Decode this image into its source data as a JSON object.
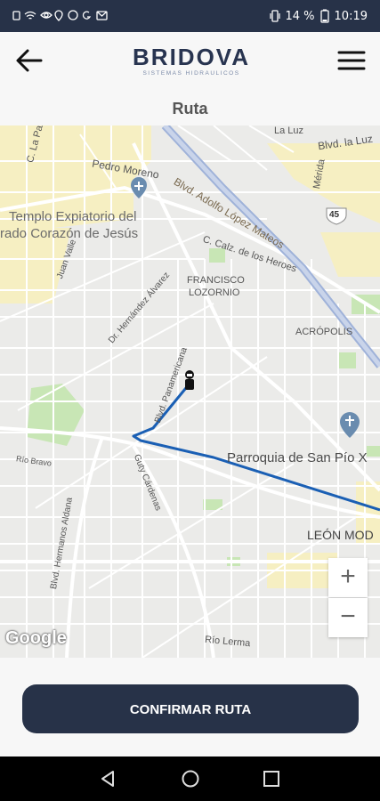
{
  "status_bar": {
    "battery": "14 %",
    "time": "10:19"
  },
  "header": {
    "logo_text": "BRIDOVA",
    "logo_subtitle": "SISTEMAS HIDRAULICOS",
    "title": "Ruta"
  },
  "map": {
    "labels": {
      "la_luz": "La Luz",
      "blvd_la_luz": "Blvd. la Luz",
      "c_la_paz": "C. La Paz",
      "pedro_moreno": "Pedro Moreno",
      "blvd_adolfo": "Blvd. Adolfo López Mateos",
      "templo_1": "Templo Expiatorio del",
      "templo_2": "rado Corazón de Jesús",
      "route_45": "45",
      "c_calz_heroes": "C. Calz. de los Heroes",
      "francisco_1": "FRANCISCO",
      "francisco_2": "LOZORNIO",
      "acropolis": "ACRÓPOLIS",
      "juan_valle": "Juan Valle",
      "dr_hernandez": "Dr. Hernández Álvarez",
      "blvd_panamericana": "Blvd. Panamericana",
      "parroquia": "Parroquia de San Pío X",
      "guty": "Guty Cárdenas",
      "leon_mod": "LEÓN MOD",
      "blvd_hermanos": "Blvd. Hermanos Aldana",
      "rio_lerma": "Río Lerma",
      "merida": "Mérida",
      "rio_bravo": "Río Bravo"
    },
    "zoom_in": "+",
    "zoom_out": "−",
    "attribution": "Google",
    "route_color": "#1a5fb4"
  },
  "actions": {
    "confirm_label": "CONFIRMAR RUTA"
  },
  "colors": {
    "brand": "#273248",
    "route": "#1a5fb4"
  }
}
